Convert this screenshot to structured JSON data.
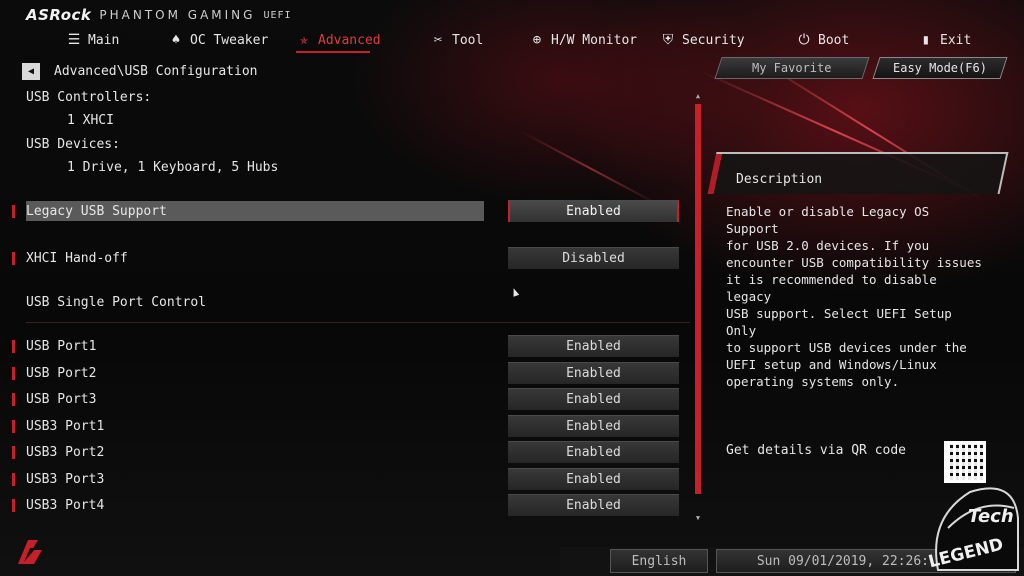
{
  "header": {
    "brand": "ASRock",
    "product": "PHANTOM GAMING",
    "uefi": "UEFI"
  },
  "nav": [
    {
      "label": "Main",
      "icon": "list-icon"
    },
    {
      "label": "OC Tweaker",
      "icon": "rocket-icon"
    },
    {
      "label": "Advanced",
      "icon": "star-icon",
      "active": true
    },
    {
      "label": "Tool",
      "icon": "tools-icon"
    },
    {
      "label": "H/W Monitor",
      "icon": "crosshair-icon"
    },
    {
      "label": "Security",
      "icon": "shield-icon"
    },
    {
      "label": "Boot",
      "icon": "power-icon"
    },
    {
      "label": "Exit",
      "icon": "exit-icon"
    }
  ],
  "breadcrumb": "Advanced\\USB Configuration",
  "buttons": {
    "favorite": "My Favorite",
    "easy_mode": "Easy Mode(F6)"
  },
  "info": {
    "controllers_label": "USB Controllers:",
    "controllers_value": "1 XHCI",
    "devices_label": "USB Devices:",
    "devices_value": "1 Drive, 1 Keyboard, 5 Hubs"
  },
  "settings": [
    {
      "label": "Legacy USB Support",
      "value": "Enabled",
      "selected": true
    },
    {
      "label": "XHCI Hand-off",
      "value": "Disabled"
    }
  ],
  "section_title": "USB Single Port Control",
  "ports": [
    {
      "label": "USB Port1",
      "value": "Enabled"
    },
    {
      "label": "USB Port2",
      "value": "Enabled"
    },
    {
      "label": "USB Port3",
      "value": "Enabled"
    },
    {
      "label": "USB3 Port1",
      "value": "Enabled"
    },
    {
      "label": "USB3 Port2",
      "value": "Enabled"
    },
    {
      "label": "USB3 Port3",
      "value": "Enabled"
    },
    {
      "label": "USB3 Port4",
      "value": "Enabled"
    }
  ],
  "description": {
    "title": "Description",
    "text": "Enable or disable Legacy OS Support\nfor USB 2.0 devices. If you\nencounter USB compatibility issues\nit is recommended to disable legacy\nUSB support. Select UEFI Setup Only\nto support USB devices under the\nUEFI setup and Windows/Linux\noperating systems only.",
    "qr_label": "Get details via QR code"
  },
  "footer": {
    "language": "English",
    "datetime": "Sun 09/01/2019, 22:26:"
  },
  "watermark": {
    "line1": "Tech",
    "line2": "LEGEND"
  },
  "colors": {
    "accent": "#c8202a",
    "text": "#e6e6e6",
    "selected_bg": "#5a5a5a"
  }
}
